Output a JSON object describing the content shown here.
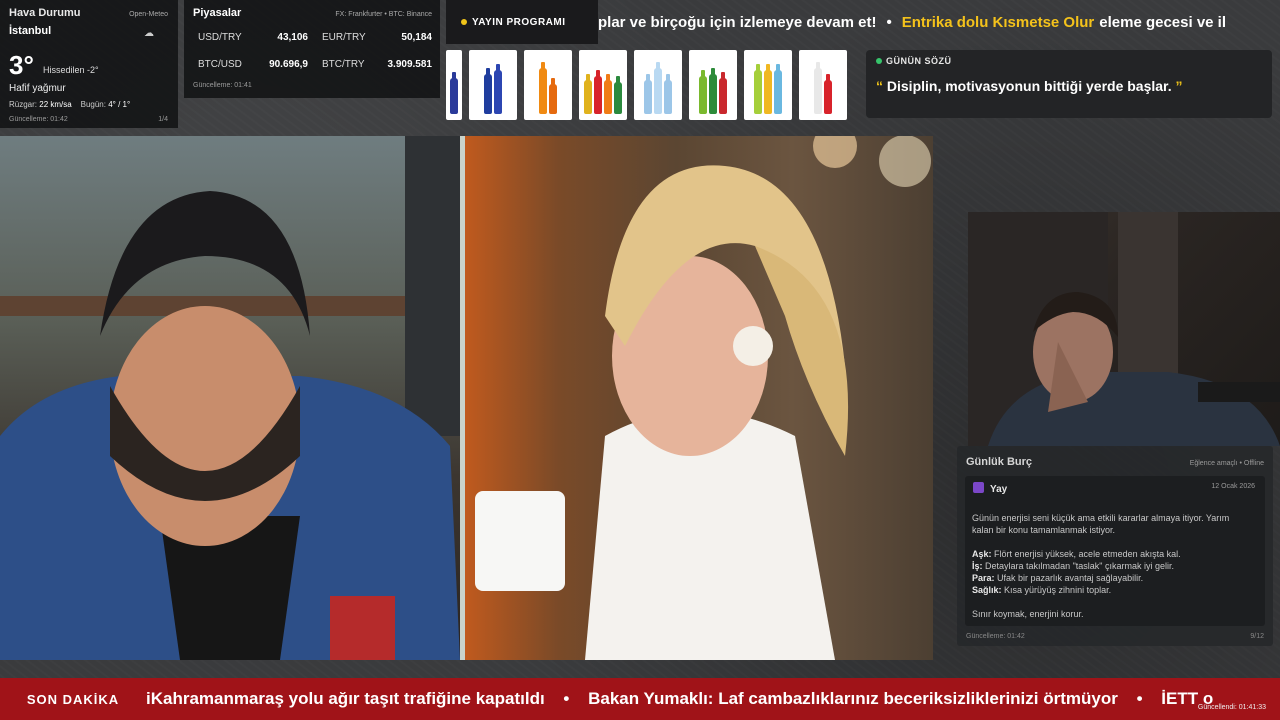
{
  "weather": {
    "title": "Hava Durumu",
    "source": "Open-Meteo",
    "city": "İstanbul",
    "temp": "3°",
    "feels": "Hissedilen -2°",
    "description": "Hafif yağmur",
    "wind_label": "Rüzgar:",
    "wind_value": "22 km/sa",
    "today_label": "Bugün:",
    "today_value": "4° / 1°",
    "updated": "Güncelleme: 01:42",
    "page": "1/4"
  },
  "markets": {
    "title": "Piyasalar",
    "source": "FX: Frankfurter • BTC: Binance",
    "rates": [
      {
        "pair": "USD/TRY",
        "value": "43,106"
      },
      {
        "pair": "EUR/TRY",
        "value": "50,184"
      },
      {
        "pair": "BTC/USD",
        "value": "90.696,9"
      },
      {
        "pair": "BTC/TRY",
        "value": "3.909.581"
      }
    ],
    "updated": "Güncelleme: 01:41"
  },
  "program_tab": {
    "label": "YAYIN PROGRAMI",
    "dot_color": "#f0c419"
  },
  "top_ticker": {
    "part1": "plar ve birçoğu için izlemeye devam et!",
    "sep": "•",
    "highlight": "Entrika dolu Kısmetse Olur",
    "part2": "eleme gecesi ve il"
  },
  "quote": {
    "label": "GÜNÜN SÖZÜ",
    "open_mark": "“",
    "text": "Disiplin, motivasyonun bittiği yerde başlar.",
    "close_mark": "”"
  },
  "horoscope": {
    "title": "Günlük Burç",
    "tag": "Eğlence amaçlı • Offline",
    "sign": "Yay",
    "date": "12 Ocak 2026",
    "summary_1": "Günün enerjisi seni küçük ama etkili kararlar almaya itiyor. Yarım",
    "summary_2": "kalan bir konu tamamlanmak istiyor.",
    "love_label": "Aşk:",
    "love": "Flört enerjisi yüksek, acele etmeden akışta kal.",
    "work_label": "İş:",
    "work": "Detaylara takılmadan \"taslak\" çıkarmak iyi gelir.",
    "money_label": "Para:",
    "money": "Ufak bir pazarlık avantaj sağlayabilir.",
    "health_label": "Sağlık:",
    "health": "Kısa yürüyüş zihnini toplar.",
    "advice": "Sınır koymak, enerjini korur.",
    "updated": "Güncelleme: 01:42",
    "page": "9/12"
  },
  "breaking": {
    "label": "SON DAKİKA",
    "item1": "iKahramanmaraş yolu ağır taşıt trafiğine kapatıldı",
    "sep": "•",
    "item2": "Bakan Yumaklı: Laf cambazlıklarınız beceriksizliklerinizi örtmüyor",
    "item3": "İETT o",
    "updated": "Güncellendi: 01:41:33"
  },
  "colors": {
    "accent": "#f4c21b",
    "breaking_bg": "#a01318",
    "live_dot": "#36c46b"
  }
}
